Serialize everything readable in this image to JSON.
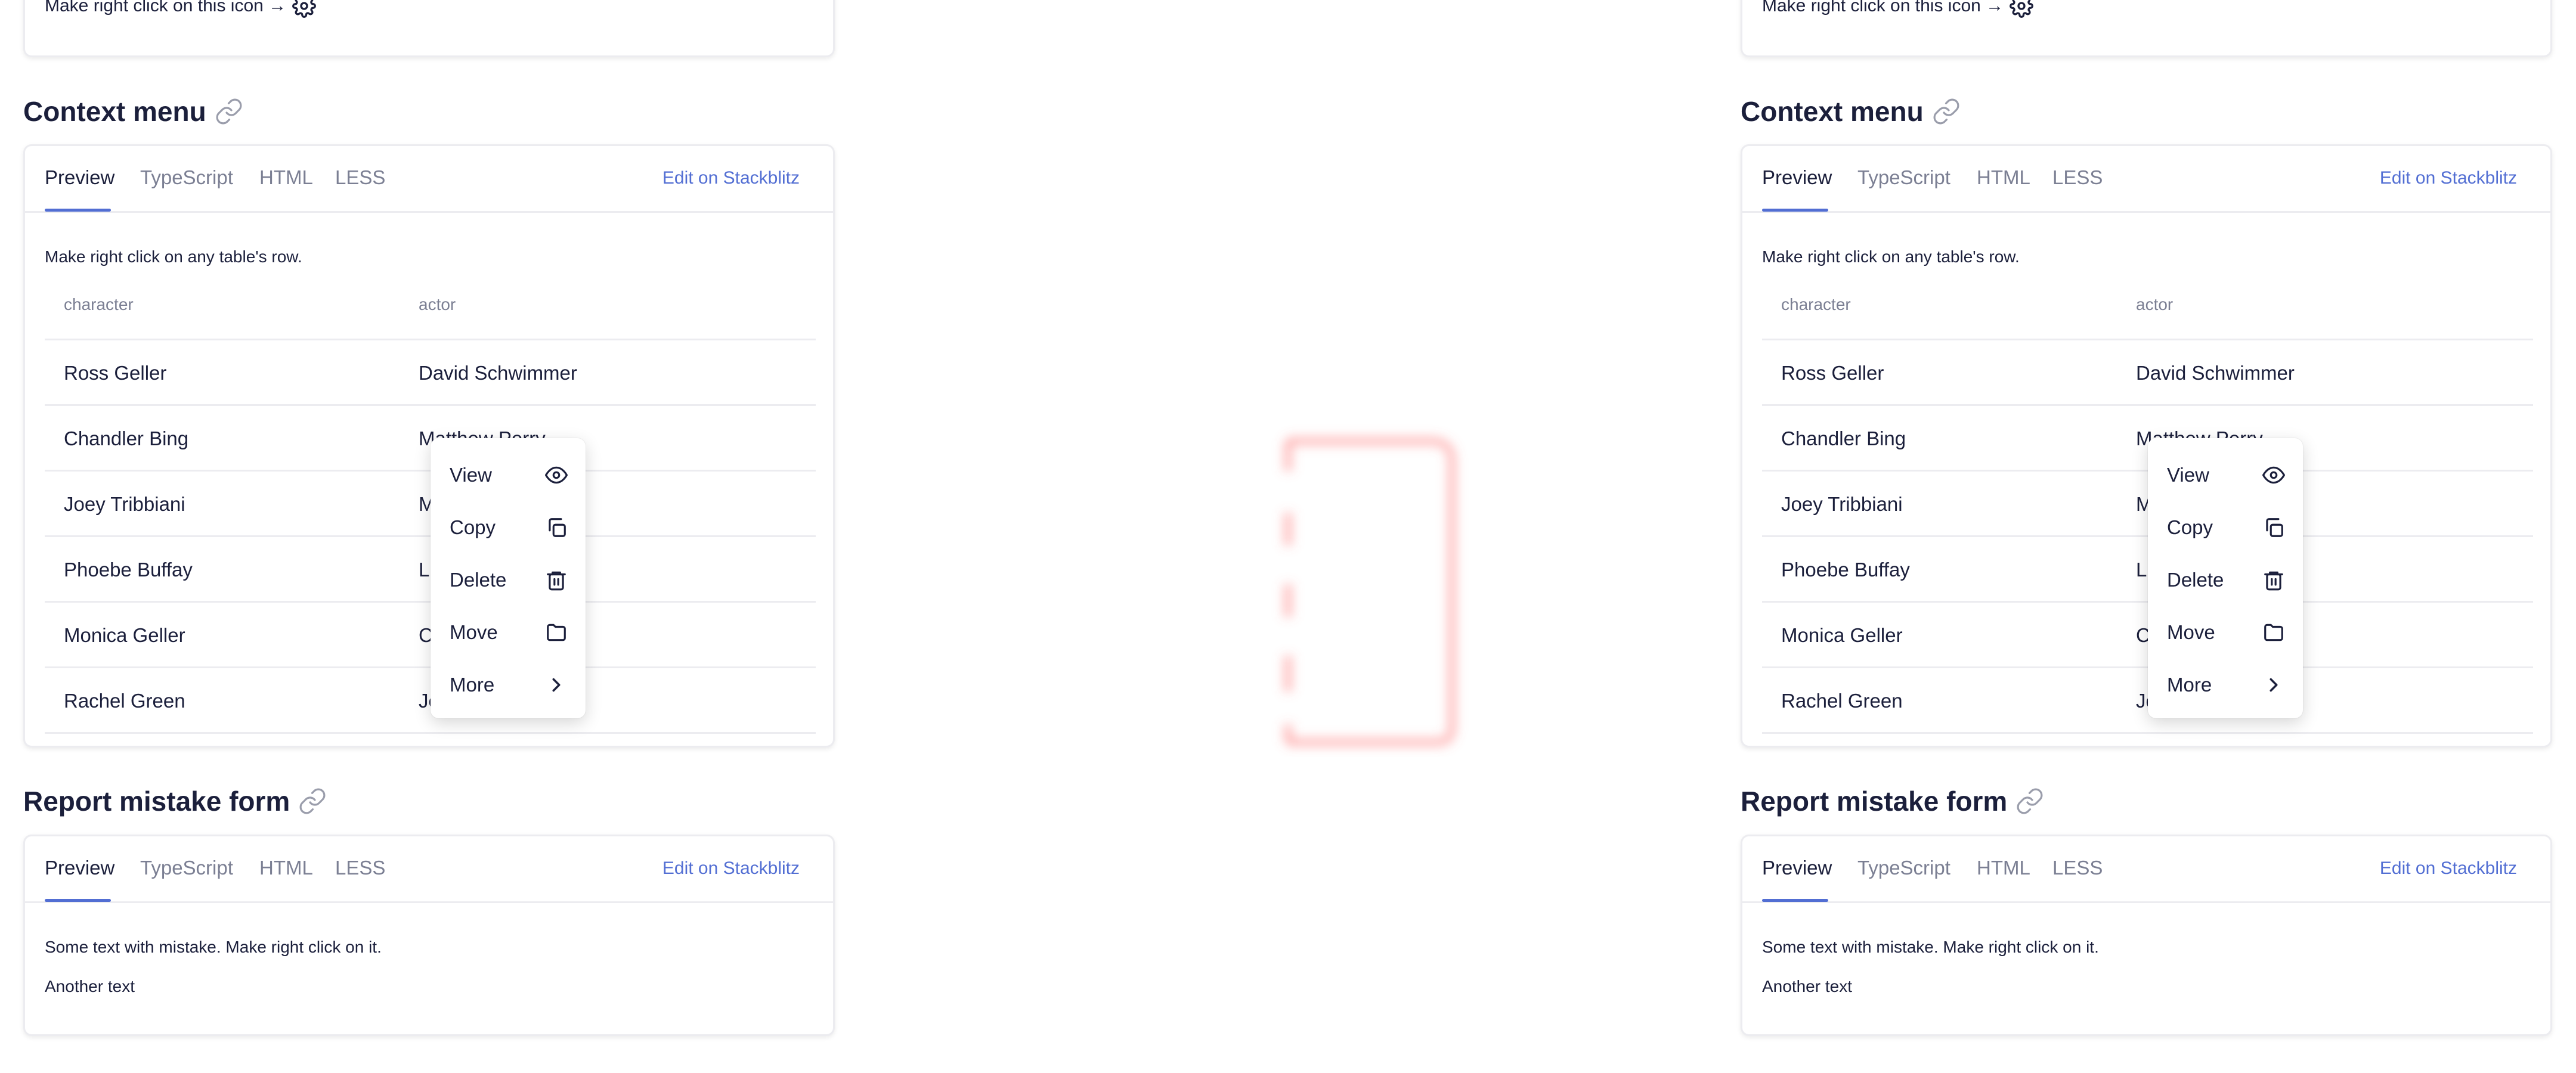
{
  "panels": [
    {
      "top_card": {
        "hint": "Make right click on this icon →"
      },
      "context_section": {
        "title": "Context menu",
        "tabs": [
          "Preview",
          "TypeScript",
          "HTML",
          "LESS"
        ],
        "edit_link": "Edit on Stackblitz",
        "description": "Make right click on any table's row.",
        "table": {
          "columns": [
            "character",
            "actor"
          ],
          "rows": [
            [
              "Ross Geller",
              "David Schwimmer"
            ],
            [
              "Chandler Bing",
              "Matthew Perry"
            ],
            [
              "Joey Tribbiani",
              "M"
            ],
            [
              "Phoebe Buffay",
              "Li"
            ],
            [
              "Monica Geller",
              "C"
            ],
            [
              "Rachel Green",
              "Je"
            ]
          ]
        },
        "menu": [
          {
            "label": "View",
            "icon": "eye-icon"
          },
          {
            "label": "Copy",
            "icon": "copy-icon"
          },
          {
            "label": "Delete",
            "icon": "trash-icon"
          },
          {
            "label": "Move",
            "icon": "folder-icon"
          },
          {
            "label": "More",
            "icon": "chevron-right-icon"
          }
        ]
      },
      "report_section": {
        "title": "Report mistake form",
        "tabs": [
          "Preview",
          "TypeScript",
          "HTML",
          "LESS"
        ],
        "edit_link": "Edit on Stackblitz",
        "text1": "Some text with mistake. Make right click on it.",
        "text2": "Another text"
      }
    },
    {
      "top_card": {
        "hint": "Make right click on this icon →"
      },
      "context_section": {
        "title": "Context menu",
        "tabs": [
          "Preview",
          "TypeScript",
          "HTML",
          "LESS"
        ],
        "edit_link": "Edit on Stackblitz",
        "description": "Make right click on any table's row.",
        "table": {
          "columns": [
            "character",
            "actor"
          ],
          "rows": [
            [
              "Ross Geller",
              "David Schwimmer"
            ],
            [
              "Chandler Bing",
              "Matthew Perry"
            ],
            [
              "Joey Tribbiani",
              "M"
            ],
            [
              "Phoebe Buffay",
              "Li"
            ],
            [
              "Monica Geller",
              "C"
            ],
            [
              "Rachel Green",
              "Je"
            ]
          ]
        },
        "menu": [
          {
            "label": "View",
            "icon": "eye-icon"
          },
          {
            "label": "Copy",
            "icon": "copy-icon"
          },
          {
            "label": "Delete",
            "icon": "trash-icon"
          },
          {
            "label": "Move",
            "icon": "folder-icon"
          },
          {
            "label": "More",
            "icon": "chevron-right-icon"
          }
        ]
      },
      "report_section": {
        "title": "Report mistake form",
        "tabs": [
          "Preview",
          "TypeScript",
          "HTML",
          "LESS"
        ],
        "edit_link": "Edit on Stackblitz",
        "text1": "Some text with mistake. Make right click on it.",
        "text2": "Another text"
      }
    }
  ],
  "colors": {
    "accent": "#526ed3",
    "text": "#1b1f3b",
    "muted": "#7b7f93",
    "border": "#ececf0",
    "ghost": "#ff6b6b"
  }
}
